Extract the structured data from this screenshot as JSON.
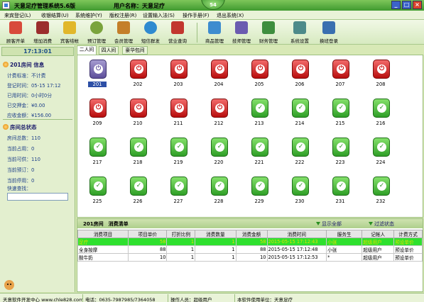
{
  "window": {
    "title": "天意足疗管理系统5.6版",
    "user_label": "用户名称：天意足疗",
    "badge": "54",
    "min": "_",
    "max": "□",
    "close": "×"
  },
  "menu": [
    "来宾登记(L)",
    "收银结算(U)",
    "系统维护(Y)",
    "版权注册(R)",
    "设置输入法(S)",
    "操作手册(F)",
    "退出系统(X)"
  ],
  "toolbar": [
    {
      "label": "顾客开单",
      "icon": "customer-icon",
      "color": "#d84a3b"
    },
    {
      "label": "增加消费",
      "icon": "wine-icon",
      "color": "#9b2d2d"
    },
    {
      "label": "宾客结帐",
      "icon": "coins-icon",
      "color": "#e1b72a"
    },
    {
      "label": "预订管理",
      "icon": "clock-icon",
      "color": "#7aa33c"
    },
    {
      "label": "会员管理",
      "icon": "members-icon",
      "color": "#c47f2a"
    },
    {
      "label": "短信群发",
      "icon": "globe-icon",
      "color": "#2f8ad0"
    },
    {
      "label": "营业查询",
      "icon": "chart-icon",
      "color": "#c2362f"
    },
    {
      "label": "商品管理",
      "icon": "goods-icon",
      "color": "#3d8ccf"
    },
    {
      "label": "技师管理",
      "icon": "tech-icon",
      "color": "#6b5bb0"
    },
    {
      "label": "财务管理",
      "icon": "money-icon",
      "color": "#3e8e3e"
    },
    {
      "label": "系统设置",
      "icon": "tools-icon",
      "color": "#4d8a8a"
    },
    {
      "label": "换班登录",
      "icon": "bird-icon",
      "color": "#3a6fb0"
    }
  ],
  "left": {
    "clock": "17:13:01",
    "room_section": "201房间 信息",
    "room_info": [
      {
        "k": "计费标准：",
        "v": "不计费"
      },
      {
        "k": "登记时间：",
        "v": "05-15 17:12"
      },
      {
        "k": "已用时间：",
        "v": "0小时0分"
      },
      {
        "k": "已交押金：",
        "v": "¥0.00"
      },
      {
        "k": "应收金额：",
        "v": "¥156.00"
      }
    ],
    "status_section": "房间总状态",
    "status_info": [
      {
        "k": "房间总数：",
        "v": "110"
      },
      {
        "k": "当前占用：",
        "v": "0"
      },
      {
        "k": "当前可供：",
        "v": "110"
      },
      {
        "k": "当前预订：",
        "v": "0"
      },
      {
        "k": "当前停用：",
        "v": "0"
      }
    ],
    "quick_label": "快速查找："
  },
  "tabs": [
    "二人间",
    "四人间",
    "豪华包间"
  ],
  "rooms": [
    {
      "num": "201",
      "state": "sel"
    },
    {
      "num": "202",
      "state": "red"
    },
    {
      "num": "203",
      "state": "red"
    },
    {
      "num": "204",
      "state": "red"
    },
    {
      "num": "205",
      "state": "red"
    },
    {
      "num": "206",
      "state": "red"
    },
    {
      "num": "207",
      "state": "red"
    },
    {
      "num": "208",
      "state": "red"
    },
    {
      "num": "209",
      "state": "red"
    },
    {
      "num": "210",
      "state": "red"
    },
    {
      "num": "211",
      "state": "red"
    },
    {
      "num": "212",
      "state": "red"
    },
    {
      "num": "213",
      "state": "green"
    },
    {
      "num": "214",
      "state": "green"
    },
    {
      "num": "215",
      "state": "green"
    },
    {
      "num": "216",
      "state": "green"
    },
    {
      "num": "217",
      "state": "green"
    },
    {
      "num": "218",
      "state": "green"
    },
    {
      "num": "219",
      "state": "green"
    },
    {
      "num": "220",
      "state": "green"
    },
    {
      "num": "221",
      "state": "green"
    },
    {
      "num": "222",
      "state": "green"
    },
    {
      "num": "223",
      "state": "green"
    },
    {
      "num": "224",
      "state": "green"
    },
    {
      "num": "225",
      "state": "green"
    },
    {
      "num": "226",
      "state": "green"
    },
    {
      "num": "227",
      "state": "green"
    },
    {
      "num": "228",
      "state": "green"
    },
    {
      "num": "229",
      "state": "green"
    },
    {
      "num": "230",
      "state": "green"
    },
    {
      "num": "231",
      "state": "green"
    },
    {
      "num": "232",
      "state": "green"
    }
  ],
  "detail": {
    "title": "201房间　消费清单",
    "show_all": "显示全部",
    "filter": "过滤状态",
    "columns": [
      "消费项目",
      "项目单价",
      "打折比例",
      "消费数量",
      "消费金额",
      "消费时间",
      "服务生",
      "记帐人",
      "计费方式"
    ],
    "rows": [
      [
        "足疗",
        "58",
        "1",
        "1",
        "58",
        "2015-05-15 17:12:43",
        "小张",
        "超级用户",
        "预设单价"
      ],
      [
        "全身按摩",
        "88",
        "1",
        "1",
        "88",
        "2015-05-15 17:12:48",
        "小张",
        "超级用户",
        "预设单价"
      ],
      [
        "酸牛奶",
        "10",
        "1",
        "1",
        "10",
        "2015-05-15 17:12:53",
        "*",
        "超级用户",
        "预设单价"
      ]
    ]
  },
  "status": [
    "天意软件开发中心 www.chle828.com",
    "电话：0635-7987985/7364058",
    "操作人员：超级用户",
    "本软件使用单位：天意足疗"
  ]
}
